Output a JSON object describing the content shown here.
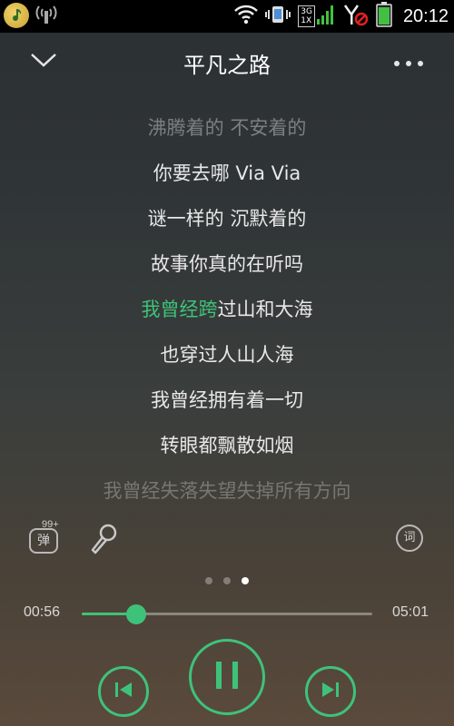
{
  "status_bar": {
    "time": "20:12",
    "network_top": "3G",
    "network_bottom": "1X",
    "colors": {
      "battery": "#43c043",
      "signal": "#43c043",
      "blocked": "#e02020"
    }
  },
  "header": {
    "song_title": "平凡之路",
    "collapse_icon": "chevron-down-icon",
    "more_icon": "more-dots-icon"
  },
  "lyrics": {
    "lines": [
      {
        "text": "沸腾着的 不安着的"
      },
      {
        "text": "你要去哪 Via Via"
      },
      {
        "text": "谜一样的 沉默着的"
      },
      {
        "text": "故事你真的在听吗"
      },
      {
        "sung": "我曾经跨",
        "rest": "过山和大海"
      },
      {
        "text": "也穿过人山人海"
      },
      {
        "text": "我曾经拥有着一切"
      },
      {
        "text": "转眼都飘散如烟"
      },
      {
        "text": "我曾经失落失望失掉所有方向"
      }
    ]
  },
  "tools": {
    "danmu_label": "弹",
    "danmu_count": "99+",
    "mic_icon": "microphone-icon",
    "lyric_label": "词"
  },
  "pager": {
    "count": 3,
    "active": 3
  },
  "progress": {
    "elapsed": "00:56",
    "total": "05:01",
    "fraction": 0.186
  },
  "controls": {
    "prev_icon": "previous-track-icon",
    "play_icon": "pause-icon",
    "next_icon": "next-track-icon"
  },
  "accent_color": "#3ec27a"
}
